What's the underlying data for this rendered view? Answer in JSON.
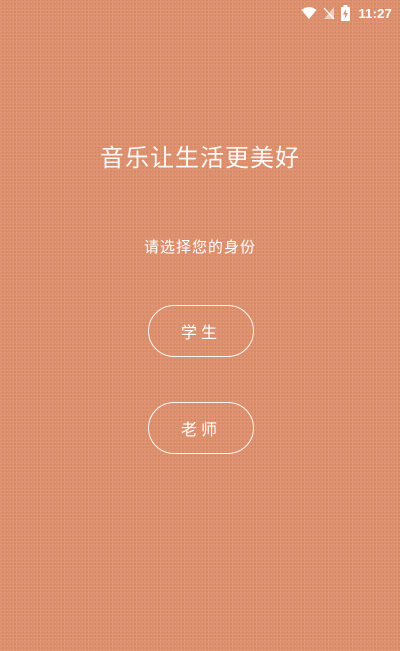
{
  "status_bar": {
    "time": "11:27",
    "icons": [
      "wifi-icon",
      "signal-icon",
      "battery-charging-icon"
    ],
    "icon_color": "#ffffff"
  },
  "main": {
    "slogan": "音乐让生活更美好",
    "prompt": "请选择您的身份",
    "buttons": [
      {
        "label": "学生"
      },
      {
        "label": "老师"
      }
    ]
  },
  "colors": {
    "background": "#dd8e6b",
    "text": "#ffffff",
    "button_border": "#ffffff"
  }
}
